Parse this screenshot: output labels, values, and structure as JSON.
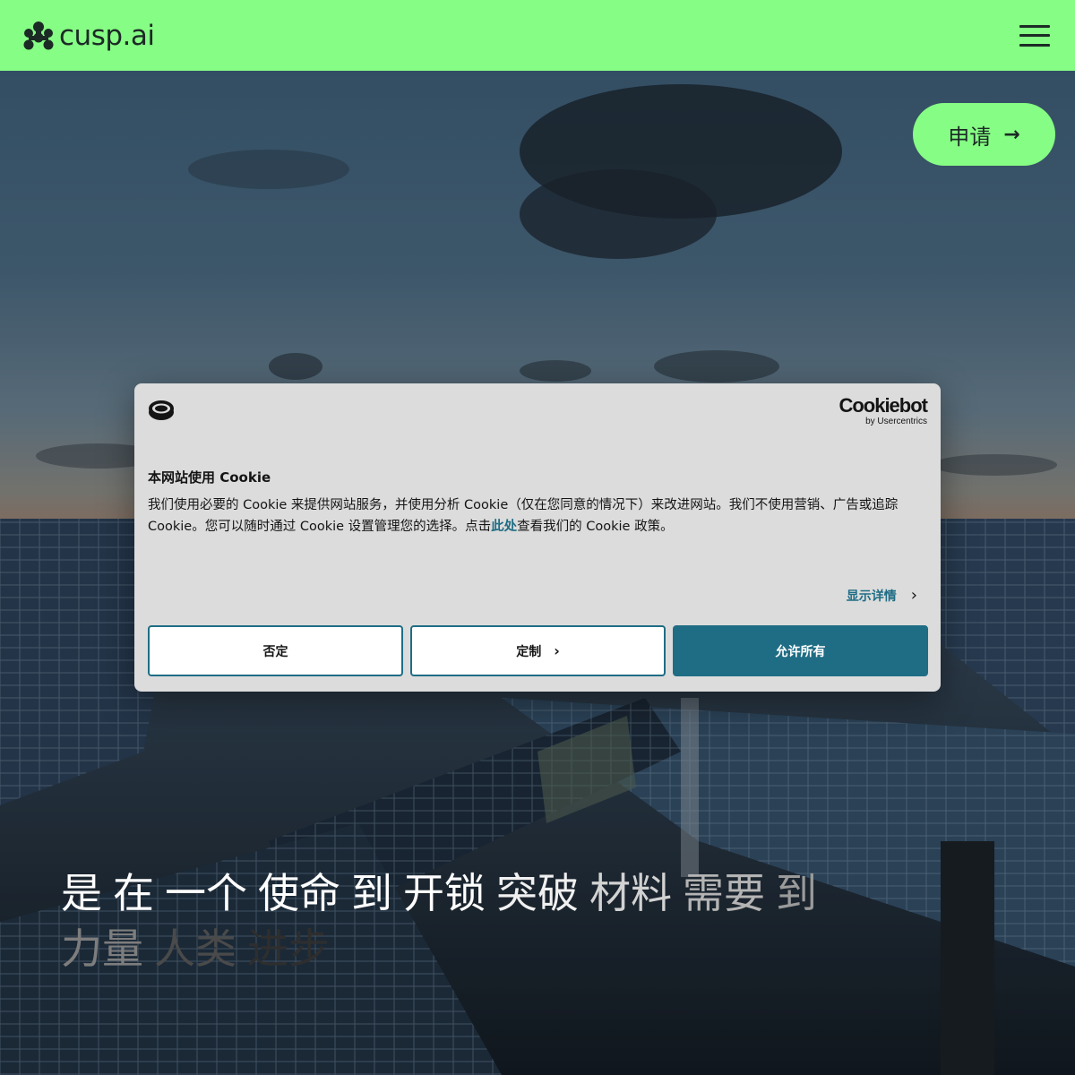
{
  "header": {
    "logo_text": "cusp.ai",
    "logo_icon": "cusp-logo-icon",
    "menu_icon": "hamburger-menu-icon",
    "background": "#86fd84"
  },
  "hero": {
    "apply_label": "申请",
    "apply_icon": "arrow-right-icon",
    "headline_words": [
      {
        "text": "是",
        "color": "#ffffff"
      },
      {
        "text": "在",
        "color": "#ffffff"
      },
      {
        "text": "一个",
        "color": "#ffffff"
      },
      {
        "text": "使命",
        "color": "#ffffff"
      },
      {
        "text": "到",
        "color": "#ffffff"
      },
      {
        "text": "开锁",
        "color": "#ffffff"
      },
      {
        "text": "突破",
        "color": "#f0f0f0"
      },
      {
        "text": "材料",
        "color": "#d2d2d2"
      },
      {
        "text": "需要",
        "color": "#b4b4b4"
      },
      {
        "text": "到",
        "color": "#9a9a9a"
      },
      {
        "text": "力量",
        "color": "#7d7d7d"
      },
      {
        "text": "人类",
        "color": "#4a4a4a"
      },
      {
        "text": "进步",
        "color": "#2e2e2e"
      }
    ]
  },
  "cookie_dialog": {
    "icon": "cookie-icon",
    "brand_name": "Cookiebot",
    "brand_by": "by Usercentrics",
    "title": "本网站使用 Cookie",
    "body_part1": "我们使用必要的 Cookie 来提供网站服务，并使用分析 Cookie（仅在您同意的情况下）来改进网站。我们不使用营销、广告或追踪 Cookie。您可以随时通过 Cookie 设置管理您的选择。点击",
    "body_link": "此处",
    "body_part2": "查看我们的 Cookie 政策。",
    "details_label": "显示详情",
    "details_icon": "chevron-right-icon",
    "buttons": {
      "deny": "否定",
      "customize": "定制",
      "allow_all": "允许所有"
    },
    "accent": "#1f6d85"
  }
}
